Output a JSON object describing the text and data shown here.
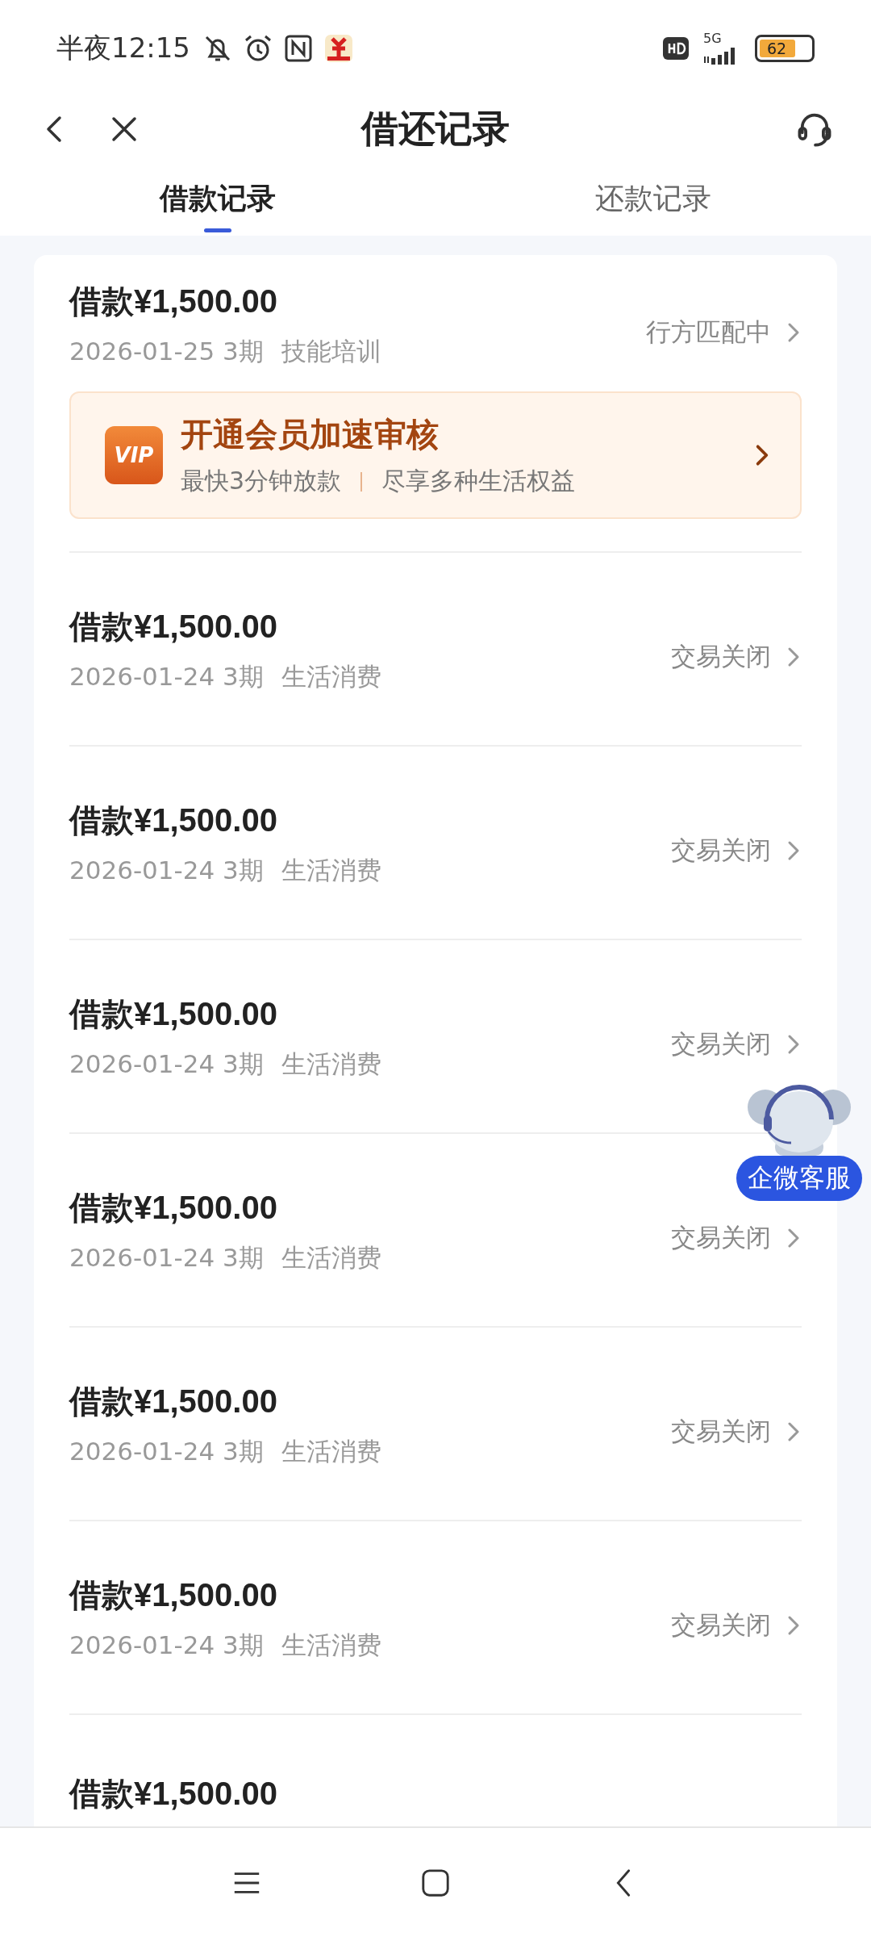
{
  "status_bar": {
    "time": "半夜12:15",
    "network": "5G",
    "battery": "62"
  },
  "header": {
    "title": "借还记录"
  },
  "tabs": [
    {
      "label": "借款记录",
      "selected": true
    },
    {
      "label": "还款记录",
      "selected": false
    }
  ],
  "records": [
    {
      "amount": "借款¥1,500.00",
      "date": "2026-01-25 3期",
      "purpose": "技能培训",
      "status": "行方匹配中",
      "promo": {
        "badge": "VIP",
        "title": "开通会员加速审核",
        "subtitle": "最快3分钟放款",
        "benefit": "尽享多种生活权益"
      }
    },
    {
      "amount": "借款¥1,500.00",
      "date": "2026-01-24 3期",
      "purpose": "生活消费",
      "status": "交易关闭"
    },
    {
      "amount": "借款¥1,500.00",
      "date": "2026-01-24 3期",
      "purpose": "生活消费",
      "status": "交易关闭"
    },
    {
      "amount": "借款¥1,500.00",
      "date": "2026-01-24 3期",
      "purpose": "生活消费",
      "status": "交易关闭"
    },
    {
      "amount": "借款¥1,500.00",
      "date": "2026-01-24 3期",
      "purpose": "生活消费",
      "status": "交易关闭"
    },
    {
      "amount": "借款¥1,500.00",
      "date": "2026-01-24 3期",
      "purpose": "生活消费",
      "status": "交易关闭"
    },
    {
      "amount": "借款¥1,500.00",
      "date": "2026-01-24 3期",
      "purpose": "生活消费",
      "status": "交易关闭"
    },
    {
      "amount": "借款¥1,500.00"
    }
  ],
  "float_service": {
    "label": "企微客服"
  }
}
